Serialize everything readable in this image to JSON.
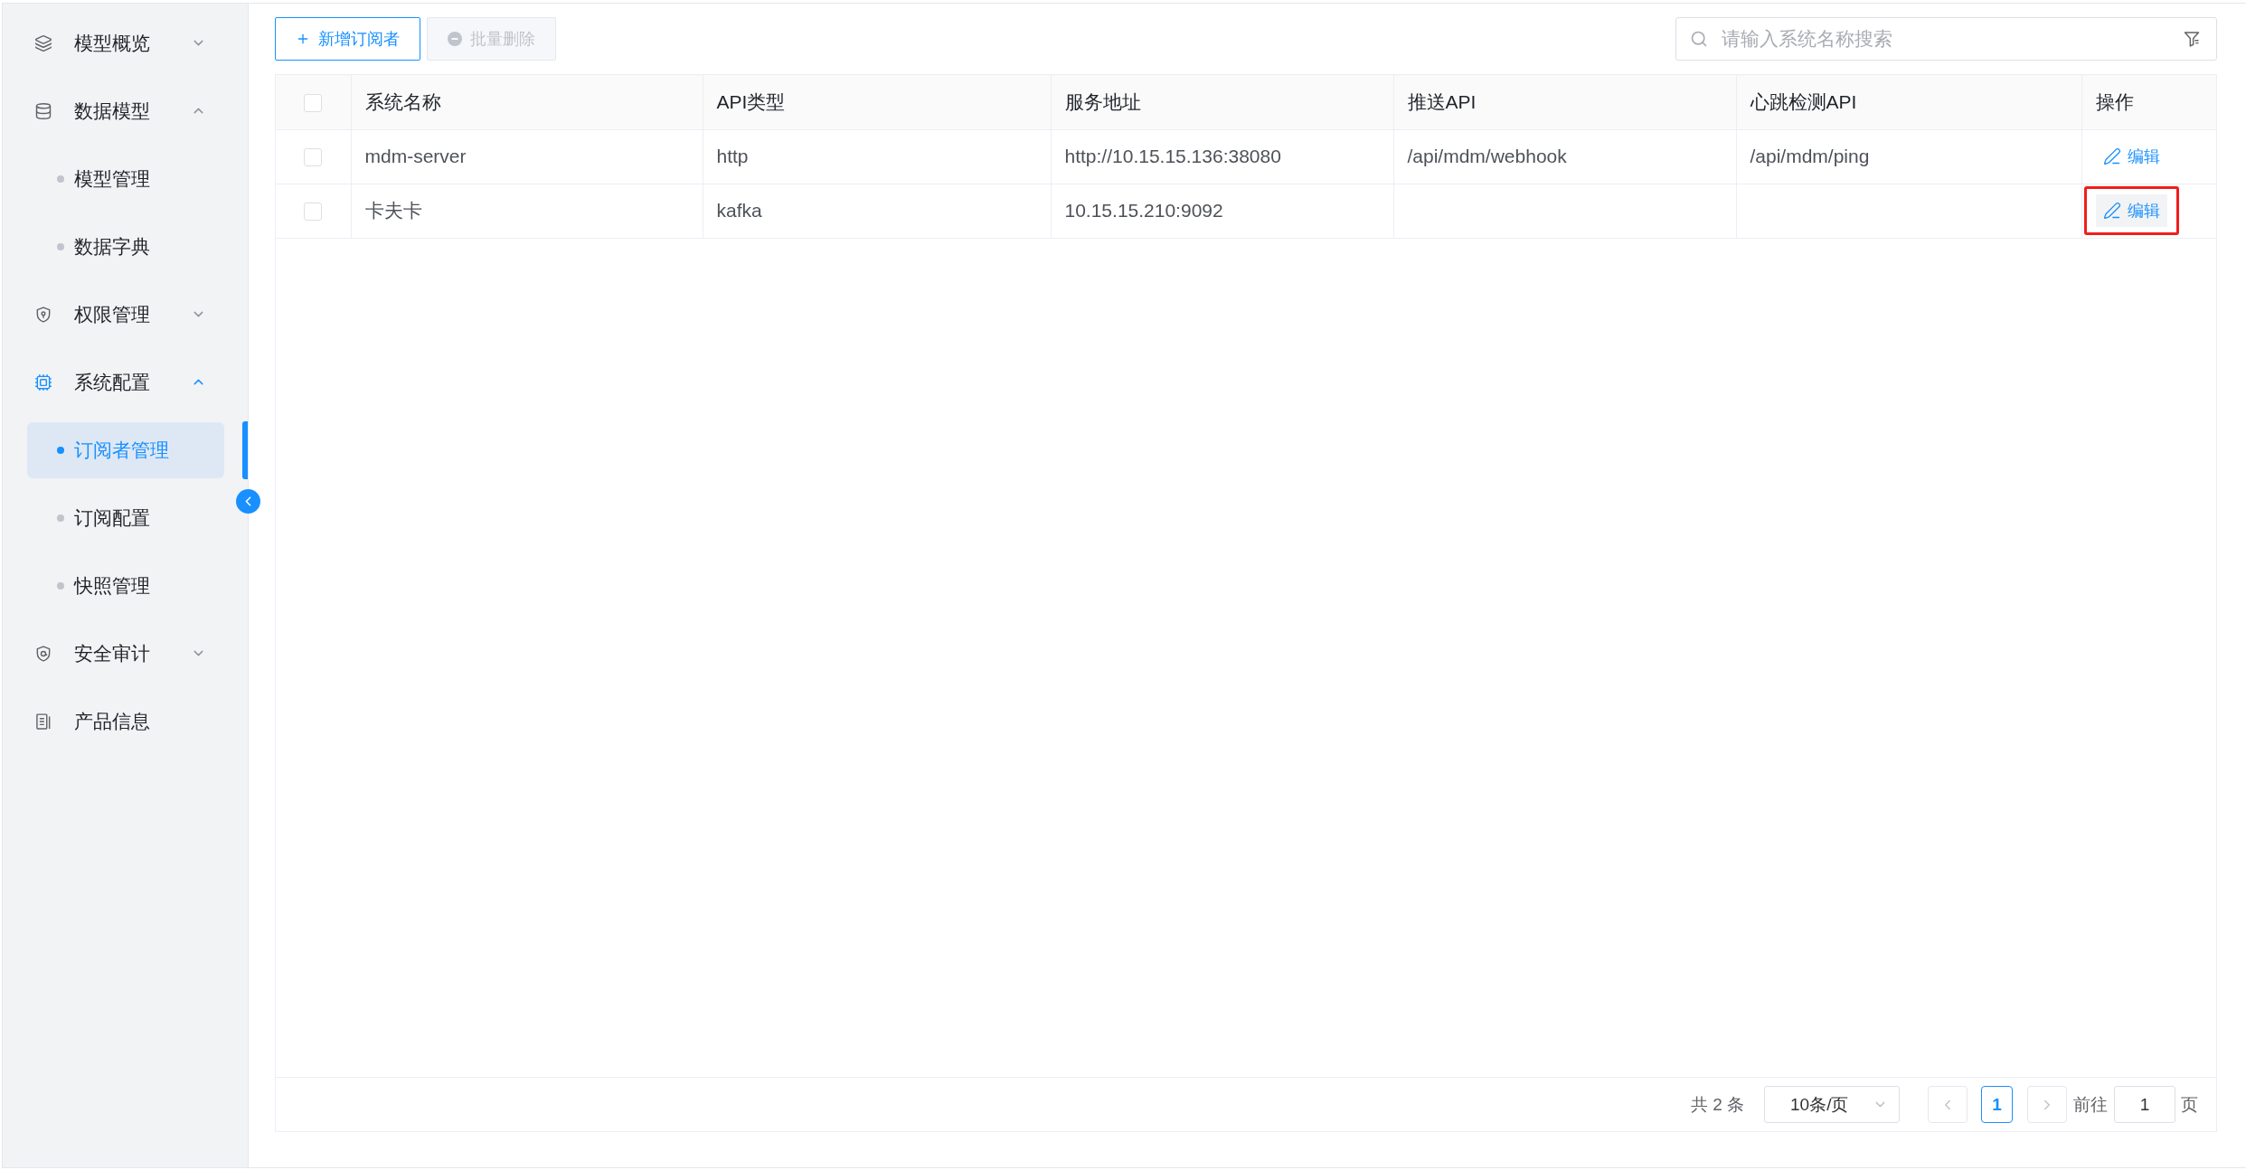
{
  "sidebar": {
    "items": [
      {
        "label": "模型概览",
        "expanded": false,
        "selected": false
      },
      {
        "label": "数据模型",
        "expanded": true,
        "selected": false,
        "children": [
          {
            "label": "模型管理",
            "selected": false
          },
          {
            "label": "数据字典",
            "selected": false
          }
        ]
      },
      {
        "label": "权限管理",
        "expanded": false,
        "selected": false
      },
      {
        "label": "系统配置",
        "expanded": true,
        "selected": false,
        "children": [
          {
            "label": "订阅者管理",
            "selected": true
          },
          {
            "label": "订阅配置",
            "selected": false
          },
          {
            "label": "快照管理",
            "selected": false
          }
        ]
      },
      {
        "label": "安全审计",
        "expanded": false,
        "selected": false
      },
      {
        "label": "产品信息",
        "selected": false
      }
    ]
  },
  "toolbar": {
    "buttons": [
      {
        "label": "新增订阅者",
        "disabled": false
      },
      {
        "label": "批量删除",
        "disabled": true
      }
    ],
    "search": {
      "placeholder": "请输入系统名称搜索"
    }
  },
  "table": {
    "select_all_checked": false,
    "columns": [
      "系统名称",
      "API类型",
      "服务地址",
      "推送API",
      "心跳检测API",
      "操作"
    ],
    "rows": [
      {
        "checked": false,
        "system_name": "mdm-server",
        "api_type": "http",
        "service_address": "http://10.15.15.136:38080",
        "push_api": "/api/mdm/webhook",
        "heartbeat_api": "/api/mdm/ping",
        "action": "编辑",
        "highlighted": false
      },
      {
        "checked": false,
        "system_name": "卡夫卡",
        "api_type": "kafka",
        "service_address": "10.15.15.210:9092",
        "action": "编辑",
        "highlighted": true
      }
    ]
  },
  "pagination": {
    "total": "共 2 条",
    "page_size": "10条/页",
    "prev_disabled": true,
    "pages": [
      {
        "label": "1",
        "selected": true
      }
    ],
    "next_disabled": true,
    "goto_label": "前往",
    "goto_value": "1",
    "page_suffix": "页"
  }
}
